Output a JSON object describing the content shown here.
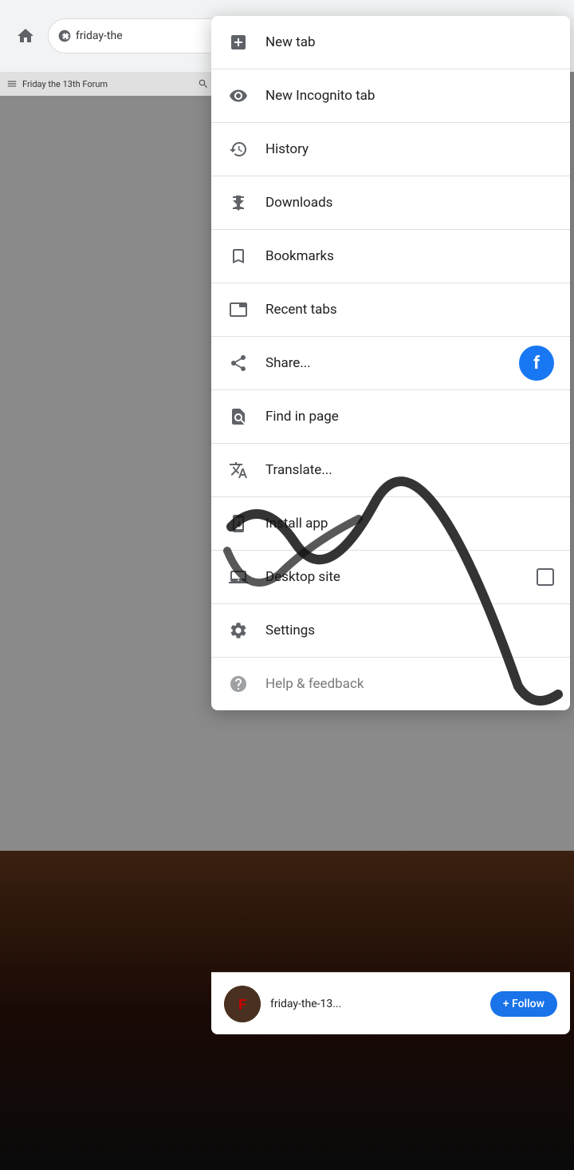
{
  "browser": {
    "url_text": "friday-the",
    "home_icon": "home-icon",
    "forward_icon": "forward-icon",
    "bookmark_icon": "bookmark-icon",
    "download_icon": "download-icon",
    "info_icon": "info-icon",
    "refresh_icon": "refresh-icon"
  },
  "tab_bar": {
    "site_label": "Friday the 13th Forum",
    "search_icon": "search-icon"
  },
  "menu": {
    "items": [
      {
        "id": "new-tab",
        "label": "New tab",
        "icon": "new-tab-icon"
      },
      {
        "id": "new-incognito-tab",
        "label": "New Incognito tab",
        "icon": "incognito-icon"
      },
      {
        "id": "history",
        "label": "History",
        "icon": "history-icon"
      },
      {
        "id": "downloads",
        "label": "Downloads",
        "icon": "downloads-icon"
      },
      {
        "id": "bookmarks",
        "label": "Bookmarks",
        "icon": "bookmarks-icon"
      },
      {
        "id": "recent-tabs",
        "label": "Recent tabs",
        "icon": "recent-tabs-icon"
      },
      {
        "id": "share",
        "label": "Share...",
        "icon": "share-icon",
        "has_fb": true
      },
      {
        "id": "find-in-page",
        "label": "Find in page",
        "icon": "find-in-page-icon"
      },
      {
        "id": "translate",
        "label": "Translate...",
        "icon": "translate-icon"
      },
      {
        "id": "install-app",
        "label": "Install app",
        "icon": "install-app-icon"
      },
      {
        "id": "desktop-site",
        "label": "Desktop site",
        "icon": "desktop-site-icon",
        "has_checkbox": true
      },
      {
        "id": "settings",
        "label": "Settings",
        "icon": "settings-icon"
      },
      {
        "id": "help-feedback",
        "label": "Help & feedback",
        "icon": "help-icon"
      }
    ]
  },
  "follow_bar": {
    "site_name": "friday-the-13...",
    "follow_label": "+ Follow",
    "avatar_icon": "site-avatar"
  }
}
